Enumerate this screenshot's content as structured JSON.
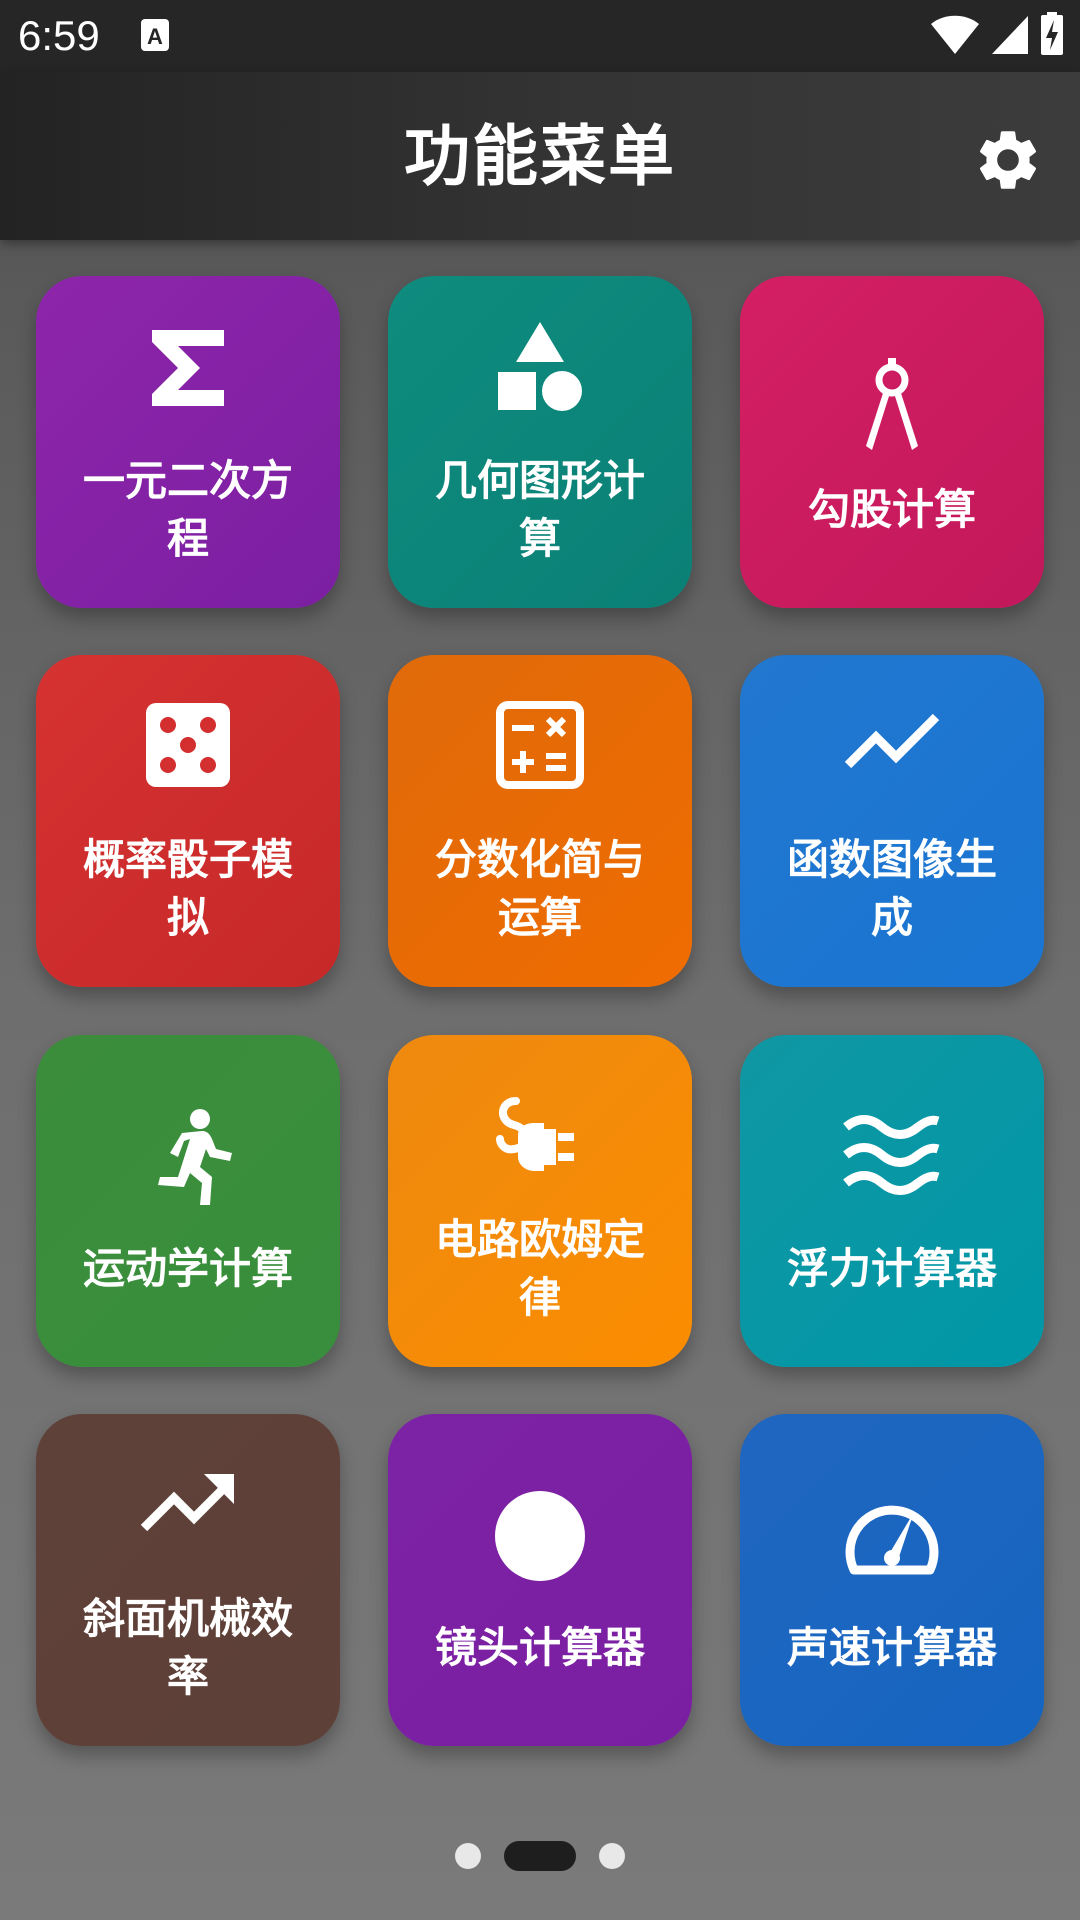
{
  "status_bar": {
    "time": "6:59",
    "icons": [
      "notification-a-icon",
      "wifi-icon",
      "signal-icon",
      "battery-charging-icon"
    ]
  },
  "app_bar": {
    "title": "功能菜单",
    "settings_icon": "gear-icon"
  },
  "tiles": [
    {
      "label": "一元二次方\n程",
      "icon": "sigma-icon",
      "color": "#8a24a8"
    },
    {
      "label": "几何图形计\n算",
      "icon": "shapes-icon",
      "color": "#0d887a"
    },
    {
      "label": "勾股计算",
      "icon": "compass-icon",
      "color": "#d41d60"
    },
    {
      "label": "概率骰子模\n拟",
      "icon": "dice-icon",
      "color": "#d32f2f"
    },
    {
      "label": "分数化简与\n运算",
      "icon": "calculator-icon",
      "color": "#ee6c00"
    },
    {
      "label": "函数图像生\n成",
      "icon": "line-chart-icon",
      "color": "#1f74cf"
    },
    {
      "label": "运动学计算",
      "icon": "running-person-icon",
      "color": "#3a8a3a"
    },
    {
      "label": "电路欧姆定\n律",
      "icon": "power-plug-icon",
      "color": "#f88a0c"
    },
    {
      "label": "浮力计算器",
      "icon": "waves-icon",
      "color": "#0e97a4"
    },
    {
      "label": "斜面机械效\n率",
      "icon": "trending-up-icon",
      "color": "#5c4037"
    },
    {
      "label": "镜头计算器",
      "icon": "circle-icon",
      "color": "#7b22a2"
    },
    {
      "label": "声速计算器",
      "icon": "speedometer-icon",
      "color": "#1e64c0"
    }
  ],
  "pager": {
    "pages": 3,
    "current": 2
  }
}
